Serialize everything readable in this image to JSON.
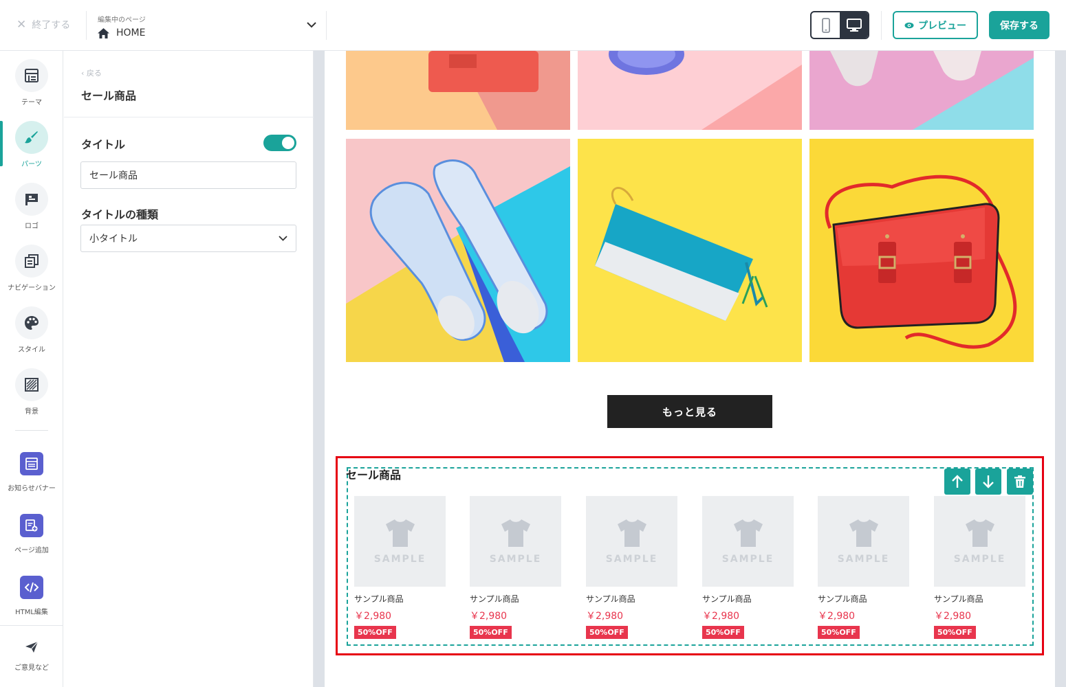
{
  "topbar": {
    "exit_label": "終了する",
    "page_caption": "編集中のページ",
    "page_name": "HOME",
    "preview_label": "プレビュー",
    "save_label": "保存する"
  },
  "rail": {
    "items": [
      {
        "label": "テーマ"
      },
      {
        "label": "パーツ"
      },
      {
        "label": "ロゴ"
      },
      {
        "label": "ナビゲーション"
      },
      {
        "label": "スタイル"
      },
      {
        "label": "背景"
      },
      {
        "label": "お知らせバナー"
      },
      {
        "label": "ページ追加"
      },
      {
        "label": "HTML編集"
      }
    ],
    "feedback_label": "ご意見など"
  },
  "panel": {
    "back_label": "戻る",
    "title": "セール商品",
    "title_field_label": "タイトル",
    "title_value": "セール商品",
    "title_type_label": "タイトルの種類",
    "title_type_value": "小タイトル"
  },
  "canvas": {
    "more_button": "もっと見る",
    "sale_title": "セール商品",
    "products": [
      {
        "name": "サンプル商品",
        "price": "￥2,980",
        "badge": "50%OFF",
        "sample": "SAMPLE"
      },
      {
        "name": "サンプル商品",
        "price": "￥2,980",
        "badge": "50%OFF",
        "sample": "SAMPLE"
      },
      {
        "name": "サンプル商品",
        "price": "￥2,980",
        "badge": "50%OFF",
        "sample": "SAMPLE"
      },
      {
        "name": "サンプル商品",
        "price": "￥2,980",
        "badge": "50%OFF",
        "sample": "SAMPLE"
      },
      {
        "name": "サンプル商品",
        "price": "￥2,980",
        "badge": "50%OFF",
        "sample": "SAMPLE"
      },
      {
        "name": "サンプル商品",
        "price": "￥2,980",
        "badge": "50%OFF",
        "sample": "SAMPLE"
      }
    ]
  },
  "colors": {
    "accent": "#1aa39a",
    "dark": "#2d3440",
    "price": "#e8354d",
    "highlight": "#e60012"
  }
}
